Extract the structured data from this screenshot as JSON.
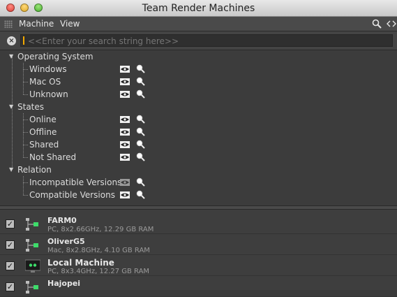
{
  "window": {
    "title": "Team Render Machines"
  },
  "menubar": {
    "items": [
      "Machine",
      "View"
    ]
  },
  "search": {
    "placeholder": "<<Enter your search string here>>",
    "value": ""
  },
  "filters": {
    "groups": [
      {
        "label": "Operating System",
        "items": [
          {
            "label": "Windows",
            "visibility": "shown"
          },
          {
            "label": "Mac OS",
            "visibility": "shown"
          },
          {
            "label": "Unknown",
            "visibility": "shown"
          }
        ]
      },
      {
        "label": "States",
        "items": [
          {
            "label": "Online",
            "visibility": "shown"
          },
          {
            "label": "Offline",
            "visibility": "shown"
          },
          {
            "label": "Shared",
            "visibility": "shown"
          },
          {
            "label": "Not Shared",
            "visibility": "shown"
          }
        ]
      },
      {
        "label": "Relation",
        "items": [
          {
            "label": "Incompatible Versions",
            "visibility": "hidden"
          },
          {
            "label": "Compatible Versions",
            "visibility": "shown"
          }
        ]
      }
    ]
  },
  "machines": [
    {
      "name": "FARM0",
      "desc": "PC, 8x2.66GHz, 12.29 GB RAM",
      "checked": true,
      "icon": "network-node-icon"
    },
    {
      "name": "OliverG5",
      "desc": "Mac, 8x2.8GHz, 4.10 GB RAM",
      "checked": true,
      "icon": "network-node-icon"
    },
    {
      "name": "Local Machine",
      "desc": "PC, 8x3.4GHz, 12.27 GB RAM",
      "checked": true,
      "icon": "monitor-icon"
    },
    {
      "name": "Hajopei",
      "desc": "",
      "checked": true,
      "icon": "network-node-icon"
    }
  ],
  "colors": {
    "accent_caret": "#f2a900",
    "node_green": "#3ddc6a"
  }
}
